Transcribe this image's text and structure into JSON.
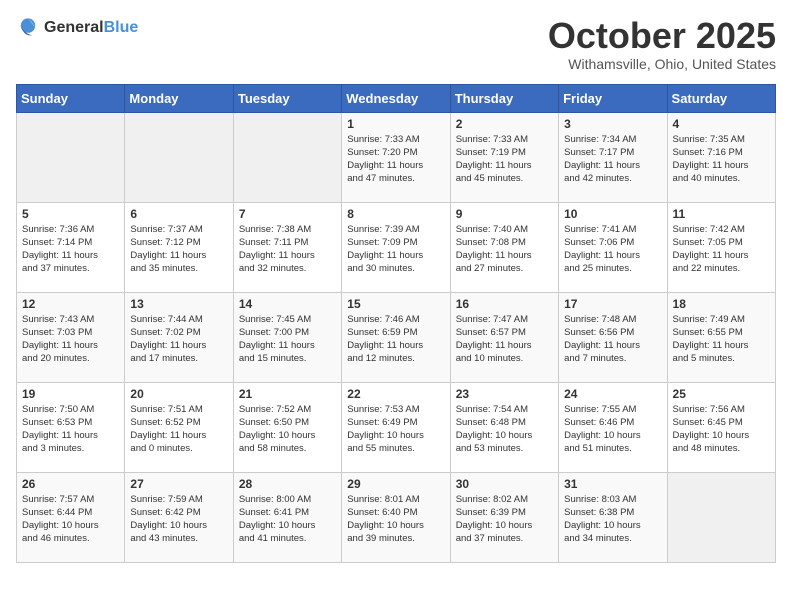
{
  "header": {
    "logo_general": "General",
    "logo_blue": "Blue",
    "month_title": "October 2025",
    "location": "Withamsville, Ohio, United States"
  },
  "days_of_week": [
    "Sunday",
    "Monday",
    "Tuesday",
    "Wednesday",
    "Thursday",
    "Friday",
    "Saturday"
  ],
  "weeks": [
    [
      {
        "day": "",
        "info": ""
      },
      {
        "day": "",
        "info": ""
      },
      {
        "day": "",
        "info": ""
      },
      {
        "day": "1",
        "info": "Sunrise: 7:33 AM\nSunset: 7:20 PM\nDaylight: 11 hours\nand 47 minutes."
      },
      {
        "day": "2",
        "info": "Sunrise: 7:33 AM\nSunset: 7:19 PM\nDaylight: 11 hours\nand 45 minutes."
      },
      {
        "day": "3",
        "info": "Sunrise: 7:34 AM\nSunset: 7:17 PM\nDaylight: 11 hours\nand 42 minutes."
      },
      {
        "day": "4",
        "info": "Sunrise: 7:35 AM\nSunset: 7:16 PM\nDaylight: 11 hours\nand 40 minutes."
      }
    ],
    [
      {
        "day": "5",
        "info": "Sunrise: 7:36 AM\nSunset: 7:14 PM\nDaylight: 11 hours\nand 37 minutes."
      },
      {
        "day": "6",
        "info": "Sunrise: 7:37 AM\nSunset: 7:12 PM\nDaylight: 11 hours\nand 35 minutes."
      },
      {
        "day": "7",
        "info": "Sunrise: 7:38 AM\nSunset: 7:11 PM\nDaylight: 11 hours\nand 32 minutes."
      },
      {
        "day": "8",
        "info": "Sunrise: 7:39 AM\nSunset: 7:09 PM\nDaylight: 11 hours\nand 30 minutes."
      },
      {
        "day": "9",
        "info": "Sunrise: 7:40 AM\nSunset: 7:08 PM\nDaylight: 11 hours\nand 27 minutes."
      },
      {
        "day": "10",
        "info": "Sunrise: 7:41 AM\nSunset: 7:06 PM\nDaylight: 11 hours\nand 25 minutes."
      },
      {
        "day": "11",
        "info": "Sunrise: 7:42 AM\nSunset: 7:05 PM\nDaylight: 11 hours\nand 22 minutes."
      }
    ],
    [
      {
        "day": "12",
        "info": "Sunrise: 7:43 AM\nSunset: 7:03 PM\nDaylight: 11 hours\nand 20 minutes."
      },
      {
        "day": "13",
        "info": "Sunrise: 7:44 AM\nSunset: 7:02 PM\nDaylight: 11 hours\nand 17 minutes."
      },
      {
        "day": "14",
        "info": "Sunrise: 7:45 AM\nSunset: 7:00 PM\nDaylight: 11 hours\nand 15 minutes."
      },
      {
        "day": "15",
        "info": "Sunrise: 7:46 AM\nSunset: 6:59 PM\nDaylight: 11 hours\nand 12 minutes."
      },
      {
        "day": "16",
        "info": "Sunrise: 7:47 AM\nSunset: 6:57 PM\nDaylight: 11 hours\nand 10 minutes."
      },
      {
        "day": "17",
        "info": "Sunrise: 7:48 AM\nSunset: 6:56 PM\nDaylight: 11 hours\nand 7 minutes."
      },
      {
        "day": "18",
        "info": "Sunrise: 7:49 AM\nSunset: 6:55 PM\nDaylight: 11 hours\nand 5 minutes."
      }
    ],
    [
      {
        "day": "19",
        "info": "Sunrise: 7:50 AM\nSunset: 6:53 PM\nDaylight: 11 hours\nand 3 minutes."
      },
      {
        "day": "20",
        "info": "Sunrise: 7:51 AM\nSunset: 6:52 PM\nDaylight: 11 hours\nand 0 minutes."
      },
      {
        "day": "21",
        "info": "Sunrise: 7:52 AM\nSunset: 6:50 PM\nDaylight: 10 hours\nand 58 minutes."
      },
      {
        "day": "22",
        "info": "Sunrise: 7:53 AM\nSunset: 6:49 PM\nDaylight: 10 hours\nand 55 minutes."
      },
      {
        "day": "23",
        "info": "Sunrise: 7:54 AM\nSunset: 6:48 PM\nDaylight: 10 hours\nand 53 minutes."
      },
      {
        "day": "24",
        "info": "Sunrise: 7:55 AM\nSunset: 6:46 PM\nDaylight: 10 hours\nand 51 minutes."
      },
      {
        "day": "25",
        "info": "Sunrise: 7:56 AM\nSunset: 6:45 PM\nDaylight: 10 hours\nand 48 minutes."
      }
    ],
    [
      {
        "day": "26",
        "info": "Sunrise: 7:57 AM\nSunset: 6:44 PM\nDaylight: 10 hours\nand 46 minutes."
      },
      {
        "day": "27",
        "info": "Sunrise: 7:59 AM\nSunset: 6:42 PM\nDaylight: 10 hours\nand 43 minutes."
      },
      {
        "day": "28",
        "info": "Sunrise: 8:00 AM\nSunset: 6:41 PM\nDaylight: 10 hours\nand 41 minutes."
      },
      {
        "day": "29",
        "info": "Sunrise: 8:01 AM\nSunset: 6:40 PM\nDaylight: 10 hours\nand 39 minutes."
      },
      {
        "day": "30",
        "info": "Sunrise: 8:02 AM\nSunset: 6:39 PM\nDaylight: 10 hours\nand 37 minutes."
      },
      {
        "day": "31",
        "info": "Sunrise: 8:03 AM\nSunset: 6:38 PM\nDaylight: 10 hours\nand 34 minutes."
      },
      {
        "day": "",
        "info": ""
      }
    ]
  ]
}
